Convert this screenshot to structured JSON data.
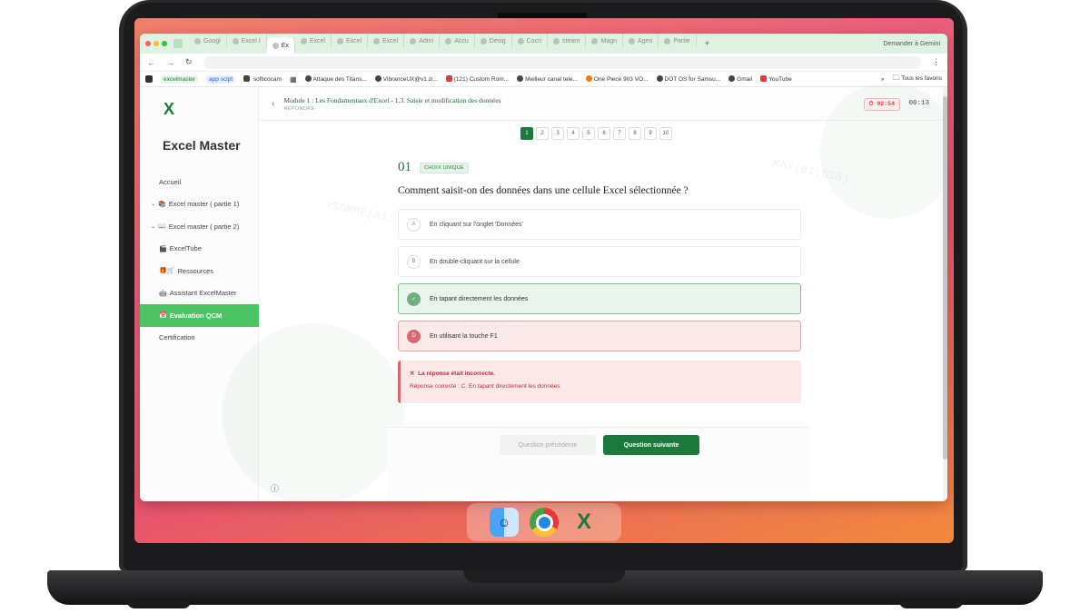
{
  "browser": {
    "tabs": [
      "Googl",
      "Excel I",
      "Ex",
      "Excel",
      "Excel",
      "Excel",
      "Admi",
      "Accu",
      "Desig",
      "Cocri",
      "stearn",
      "Magn",
      "Agen",
      "Partie"
    ],
    "active_tab": "Ex",
    "gemini_label": "Demander à Gemini",
    "bookmarks": [
      "excelmaster",
      "app scipt",
      "softicocam",
      "Attaque des Titans...",
      "VibranceUX@v1.zi...",
      "(121) Custom Rom...",
      "Meilleur canal tele...",
      "One Piece 903 VO...",
      "DOT OS for Samsu...",
      "Gmail",
      "YouTube"
    ],
    "favorites_label": "Tous les favoris"
  },
  "sidebar": {
    "logo": "X",
    "brand": "Excel Master",
    "items": [
      {
        "label": "Accueil",
        "emoji": "",
        "chevron": false
      },
      {
        "label": "Excel master ( partie 1)",
        "emoji": "📚",
        "chevron": true
      },
      {
        "label": "Excel master ( partie 2)",
        "emoji": "📖",
        "chevron": true
      },
      {
        "label": "ExcelTube",
        "emoji": "🎬",
        "chevron": false
      },
      {
        "label": "Ressources",
        "emoji": "🎁🛒",
        "chevron": false
      },
      {
        "label": "Assistant ExcelMaster",
        "emoji": "🤖",
        "chevron": false
      },
      {
        "label": "Evaluation QCM",
        "emoji": "📅",
        "chevron": false,
        "active": true
      },
      {
        "label": "Certification",
        "emoji": "",
        "chevron": false
      }
    ]
  },
  "header": {
    "module": "Module 1 : Les Fondamentaux d'Excel - 1.3. Saisie et modification des données",
    "subtitle": "RÉPONDRE",
    "timer": "02:54",
    "elapsed": "00:13"
  },
  "pager": [
    "1",
    "2",
    "3",
    "4",
    "5",
    "6",
    "7",
    "8",
    "9",
    "10"
  ],
  "pager_active": "1",
  "question": {
    "number": "01",
    "type": "CHOIX UNIQUE",
    "text": "Comment saisit-on des données dans une cellule Excel sélectionnée ?",
    "options": [
      {
        "letter": "A",
        "text": "En cliquant sur l'onglet 'Données'",
        "state": "neutral"
      },
      {
        "letter": "B",
        "text": "En double-cliquant sur la cellule",
        "state": "neutral"
      },
      {
        "letter": "✓",
        "text": "En tapant directement les données",
        "state": "correct"
      },
      {
        "letter": "D",
        "text": "En utilisant la touche F1",
        "state": "wrong"
      }
    ]
  },
  "feedback": {
    "icon": "✕",
    "title": "La réponse était incorrecte.",
    "text": "Réponse correcte : C. En tapant directement les données"
  },
  "buttons": {
    "prev": "Question précédente",
    "next": "Question suivante"
  },
  "watermarks": [
    "=SOMME(A1:",
    "MAX(B1:B58)"
  ],
  "colors": {
    "accent": "#1b7a3b",
    "active_nav": "#4cc466",
    "wrong": "#d9676f",
    "correct": "#6fb07f"
  }
}
